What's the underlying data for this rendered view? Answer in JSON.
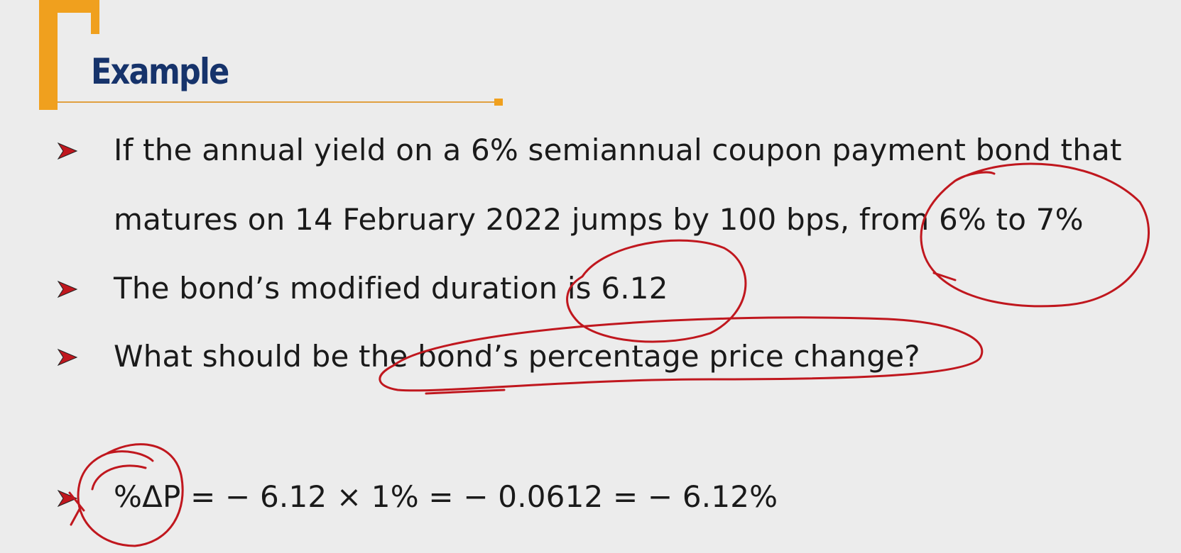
{
  "slide": {
    "title": "Example",
    "bullets": [
      "If the annual yield on a 6% semiannual coupon payment bond that",
      "matures on 14 February 2022 jumps by 100 bps, from 6% to 7%",
      "The bond’s modified duration is 6.12",
      "What should be the bond’s percentage price change?",
      "%ΔP = − 6.12 × 1% = − 0.0612 = − 6.12%"
    ]
  },
  "colors": {
    "accent": "#f0a01e",
    "title": "#16336b",
    "bullet": "#c0171e",
    "annotation": "#c0171e"
  }
}
